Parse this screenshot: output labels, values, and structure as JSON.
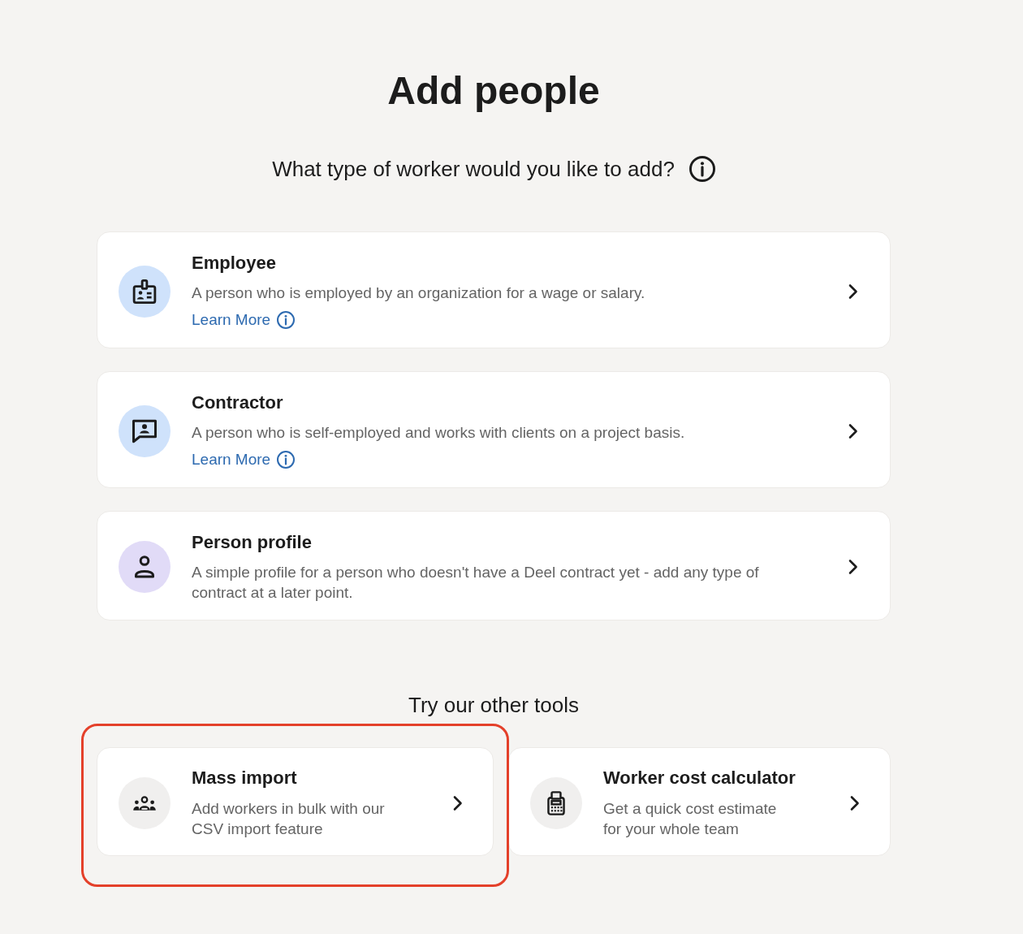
{
  "page": {
    "title": "Add people",
    "subtitle": "What type of worker would you like to add?"
  },
  "worker_types": [
    {
      "kind": "badge",
      "color": "#cfe2fb",
      "title": "Employee",
      "description": "A person who is employed by an organization for a wage or salary.",
      "link": "Learn More"
    },
    {
      "kind": "chat",
      "color": "#cfe2fb",
      "title": "Contractor",
      "description": "A person who is self-employed and works with clients on a project basis.",
      "link": "Learn More"
    },
    {
      "kind": "person",
      "color": "#e1dbf7",
      "title": "Person profile",
      "description": "A simple profile for a person who doesn't have a Deel contract yet - add any type of contract at a later point."
    }
  ],
  "tools_heading": "Try our other tools",
  "tools": [
    {
      "kind": "group",
      "title": "Mass import",
      "description": "Add workers in bulk with our CSV import feature",
      "highlighted": true
    },
    {
      "kind": "calculator",
      "title": "Worker cost calculator",
      "description": "Get a quick cost estimate for your whole team",
      "highlighted": false
    }
  ]
}
